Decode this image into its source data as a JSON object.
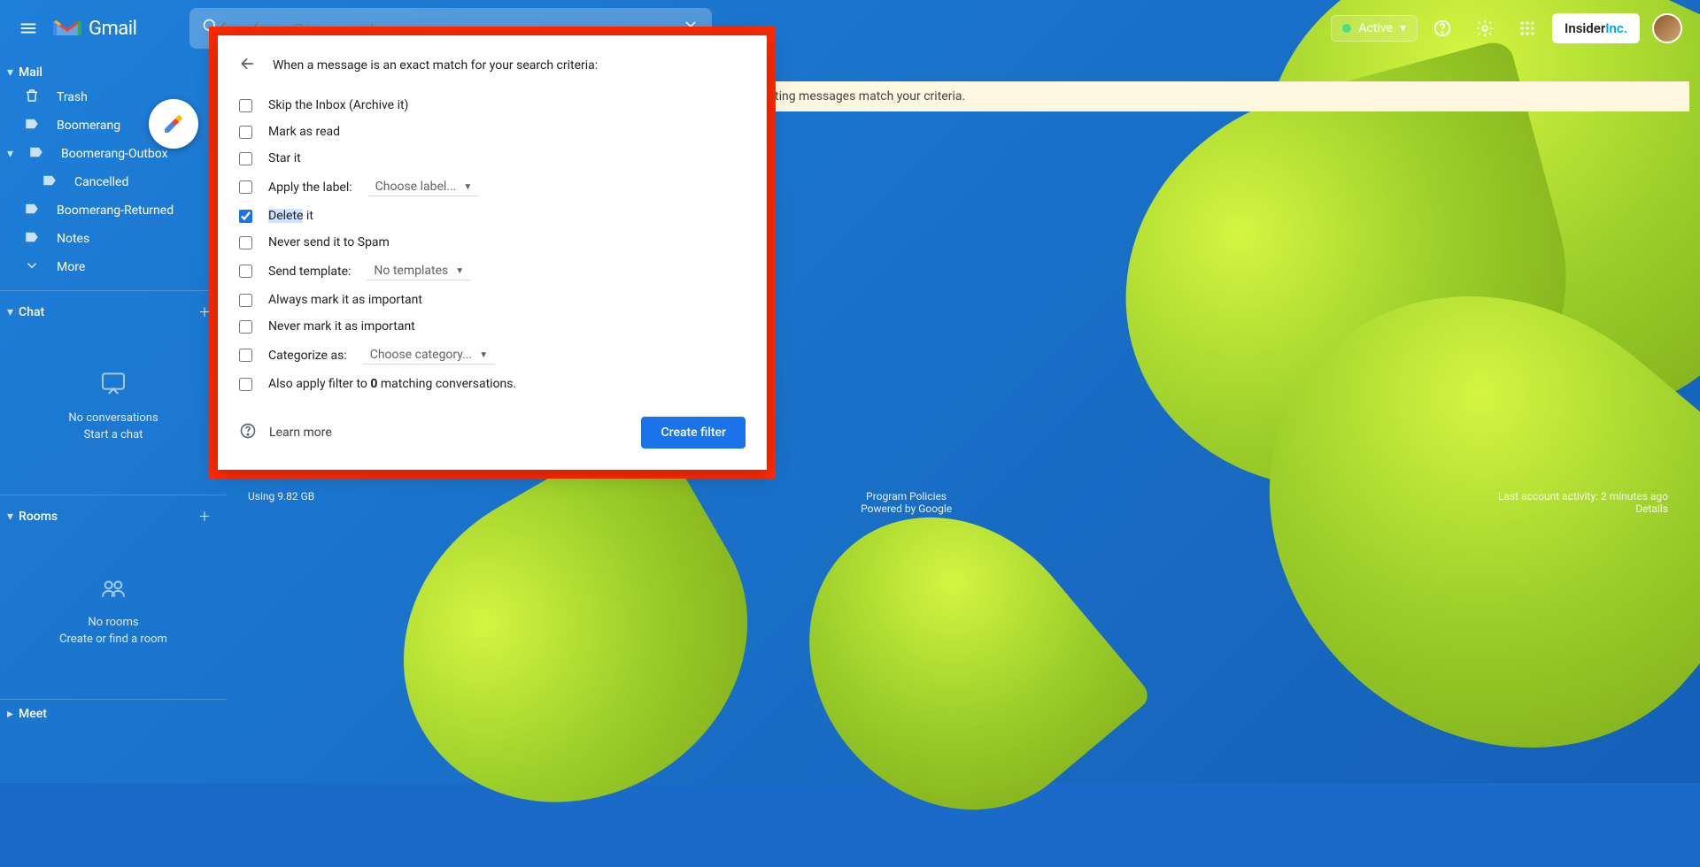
{
  "header": {
    "logo_text": "Gmail",
    "search_placeholder": "from:(spam@spam.com)",
    "status_label": "Active",
    "brand_left": "Insider",
    "brand_right": "Inc."
  },
  "sidebar": {
    "mail_label": "Mail",
    "items": [
      {
        "icon": "trash",
        "label": "Trash"
      },
      {
        "icon": "label",
        "label": "Boomerang"
      },
      {
        "icon": "label",
        "label": "Boomerang-Outbox"
      },
      {
        "icon": "label",
        "label": "Cancelled",
        "indent": true
      },
      {
        "icon": "label",
        "label": "Boomerang-Returned"
      },
      {
        "icon": "label",
        "label": "Notes"
      },
      {
        "icon": "more",
        "label": "More"
      }
    ],
    "chat_label": "Chat",
    "chat_empty_1": "No conversations",
    "chat_empty_2": "Start a chat",
    "rooms_label": "Rooms",
    "rooms_empty_1": "No rooms",
    "rooms_empty_2": "Create or find a room",
    "meet_label": "Meet"
  },
  "info_bar": "existing messages match your criteria.",
  "filter": {
    "title": "When a message is an exact match for your search criteria:",
    "options": [
      {
        "label": "Skip the Inbox (Archive it)",
        "checked": false
      },
      {
        "label": "Mark as read",
        "checked": false
      },
      {
        "label": "Star it",
        "checked": false
      },
      {
        "label": "Apply the label:",
        "checked": false,
        "dropdown": "Choose label..."
      },
      {
        "label_pre": "Delete",
        "label_post": " it",
        "checked": true,
        "highlight": true
      },
      {
        "label": "Never send it to Spam",
        "checked": false
      },
      {
        "label": "Send template:",
        "checked": false,
        "dropdown": "No templates"
      },
      {
        "label": "Always mark it as important",
        "checked": false
      },
      {
        "label": "Never mark it as important",
        "checked": false
      },
      {
        "label": "Categorize as:",
        "checked": false,
        "dropdown": "Choose category..."
      },
      {
        "label_pre": "Also apply filter to ",
        "label_bold": "0",
        "label_post": " matching conversations.",
        "checked": false
      }
    ],
    "learn_more": "Learn more",
    "create_button": "Create filter"
  },
  "footer": {
    "storage": "Using 9.82 GB",
    "policies": "Program Policies",
    "powered": "Powered by Google",
    "activity": "Last account activity: 2 minutes ago",
    "details": "Details"
  }
}
